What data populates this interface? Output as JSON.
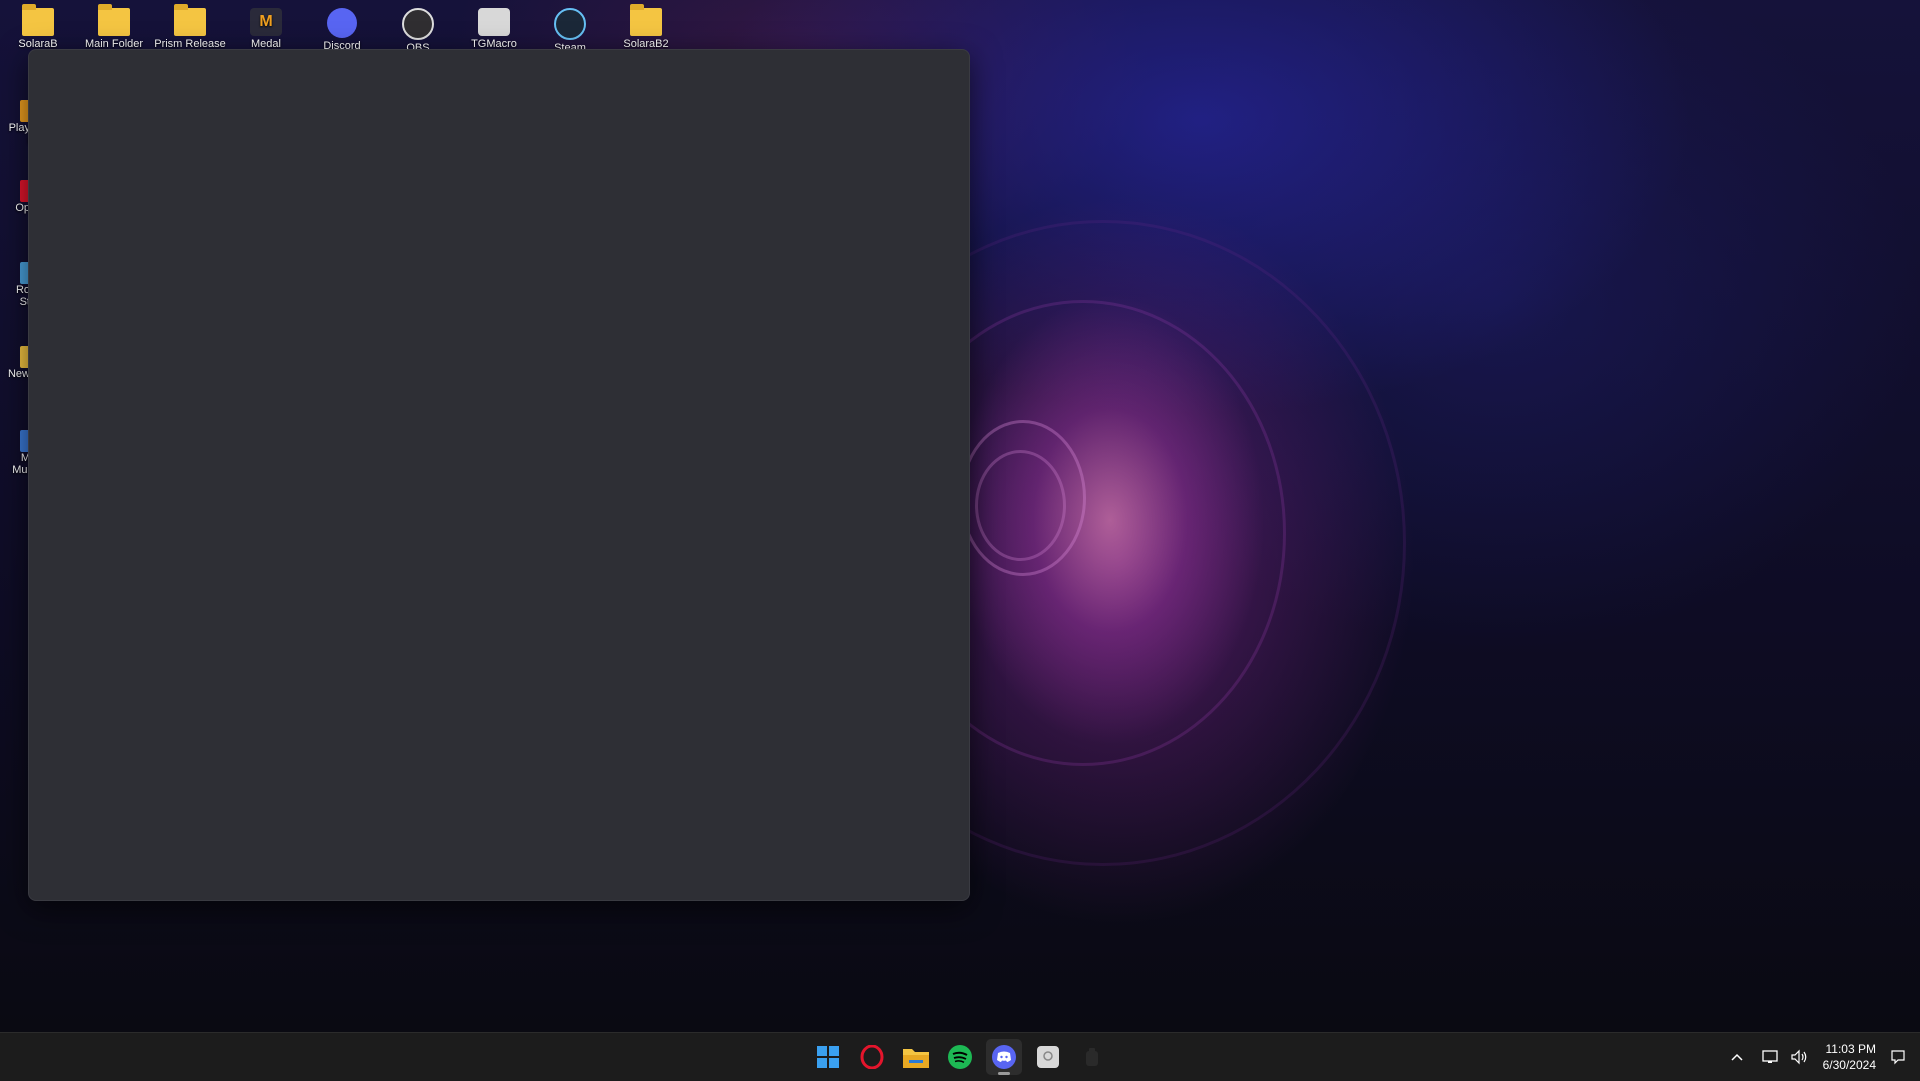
{
  "desktop": {
    "top_icons": [
      {
        "label": "SolaraB",
        "icon": "folder-icon"
      },
      {
        "label": "Main Folder",
        "icon": "folder-icon"
      },
      {
        "label": "Prism Release",
        "icon": "folder-icon"
      },
      {
        "label": "Medal",
        "icon": "medal-icon"
      },
      {
        "label": "Discord",
        "icon": "discord-icon"
      },
      {
        "label": "OBS",
        "icon": "obs-icon"
      },
      {
        "label": "TGMacro",
        "icon": "tgmacro-icon"
      },
      {
        "label": "Steam",
        "icon": "steam-icon"
      },
      {
        "label": "SolaraB2",
        "icon": "folder-icon"
      }
    ],
    "left_icons": [
      {
        "label": "Play\nI",
        "icon": "app-icon"
      },
      {
        "label": "Op",
        "icon": "opera-icon"
      },
      {
        "label": "Ro\nSt",
        "icon": "roblox-studio-icon"
      },
      {
        "label": "New",
        "icon": "folder-icon"
      },
      {
        "label": "M\nMul",
        "icon": "app-icon"
      }
    ]
  },
  "taskbar": {
    "apps": [
      {
        "name": "start",
        "icon": "windows-start-icon"
      },
      {
        "name": "opera",
        "icon": "opera-icon"
      },
      {
        "name": "file-explorer",
        "icon": "folder-icon"
      },
      {
        "name": "spotify",
        "icon": "spotify-icon"
      },
      {
        "name": "discord",
        "icon": "discord-icon",
        "active": true
      },
      {
        "name": "tgmacro",
        "icon": "tgmacro-icon"
      },
      {
        "name": "unknown",
        "icon": "app-icon"
      }
    ],
    "clock": {
      "time": "11:03 PM",
      "date": "6/30/2024"
    }
  },
  "colors": {
    "window_bg": "#2e2f35",
    "taskbar_bg": "#1c1c1c",
    "discord": "#5865f2",
    "spotify": "#1db954",
    "opera": "#e4152c",
    "folder": "#f4c542"
  }
}
